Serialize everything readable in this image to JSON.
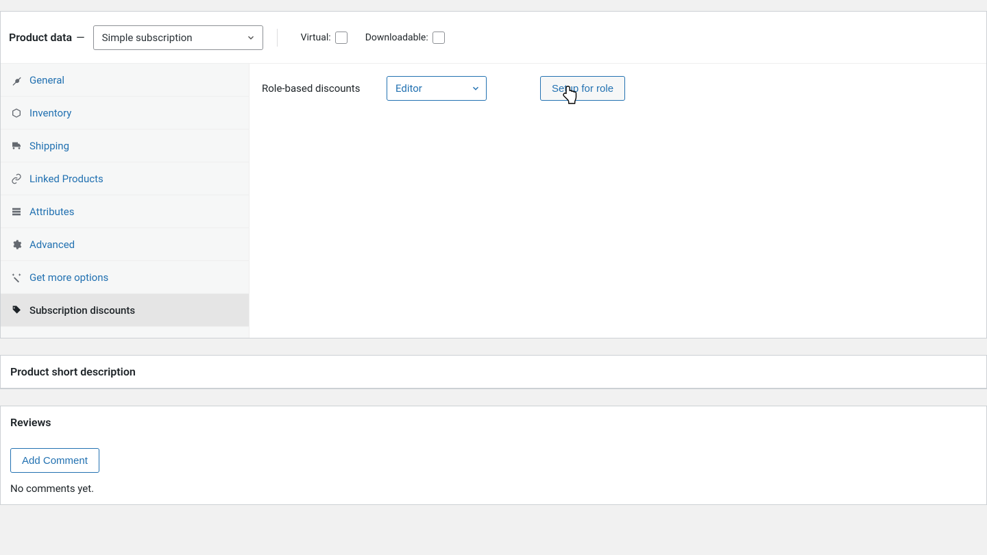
{
  "header": {
    "title": "Product data",
    "dash": "—",
    "product_type": "Simple subscription",
    "virtual_label": "Virtual:",
    "downloadable_label": "Downloadable:"
  },
  "tabs": [
    {
      "id": "general",
      "label": "General",
      "icon": "wrench-icon"
    },
    {
      "id": "inventory",
      "label": "Inventory",
      "icon": "inventory-icon"
    },
    {
      "id": "shipping",
      "label": "Shipping",
      "icon": "truck-icon"
    },
    {
      "id": "linked",
      "label": "Linked Products",
      "icon": "link-icon"
    },
    {
      "id": "attributes",
      "label": "Attributes",
      "icon": "attributes-icon"
    },
    {
      "id": "advanced",
      "label": "Advanced",
      "icon": "gear-icon"
    },
    {
      "id": "getmore",
      "label": "Get more options",
      "icon": "magic-icon"
    },
    {
      "id": "subdisc",
      "label": "Subscription discounts",
      "icon": "tag-icon",
      "active": true
    }
  ],
  "content": {
    "role_discounts_label": "Role-based discounts",
    "role_selected": "Editor",
    "setup_button": "Setup for role"
  },
  "short_desc": {
    "title": "Product short description"
  },
  "reviews": {
    "title": "Reviews",
    "add_comment": "Add Comment",
    "empty": "No comments yet."
  }
}
